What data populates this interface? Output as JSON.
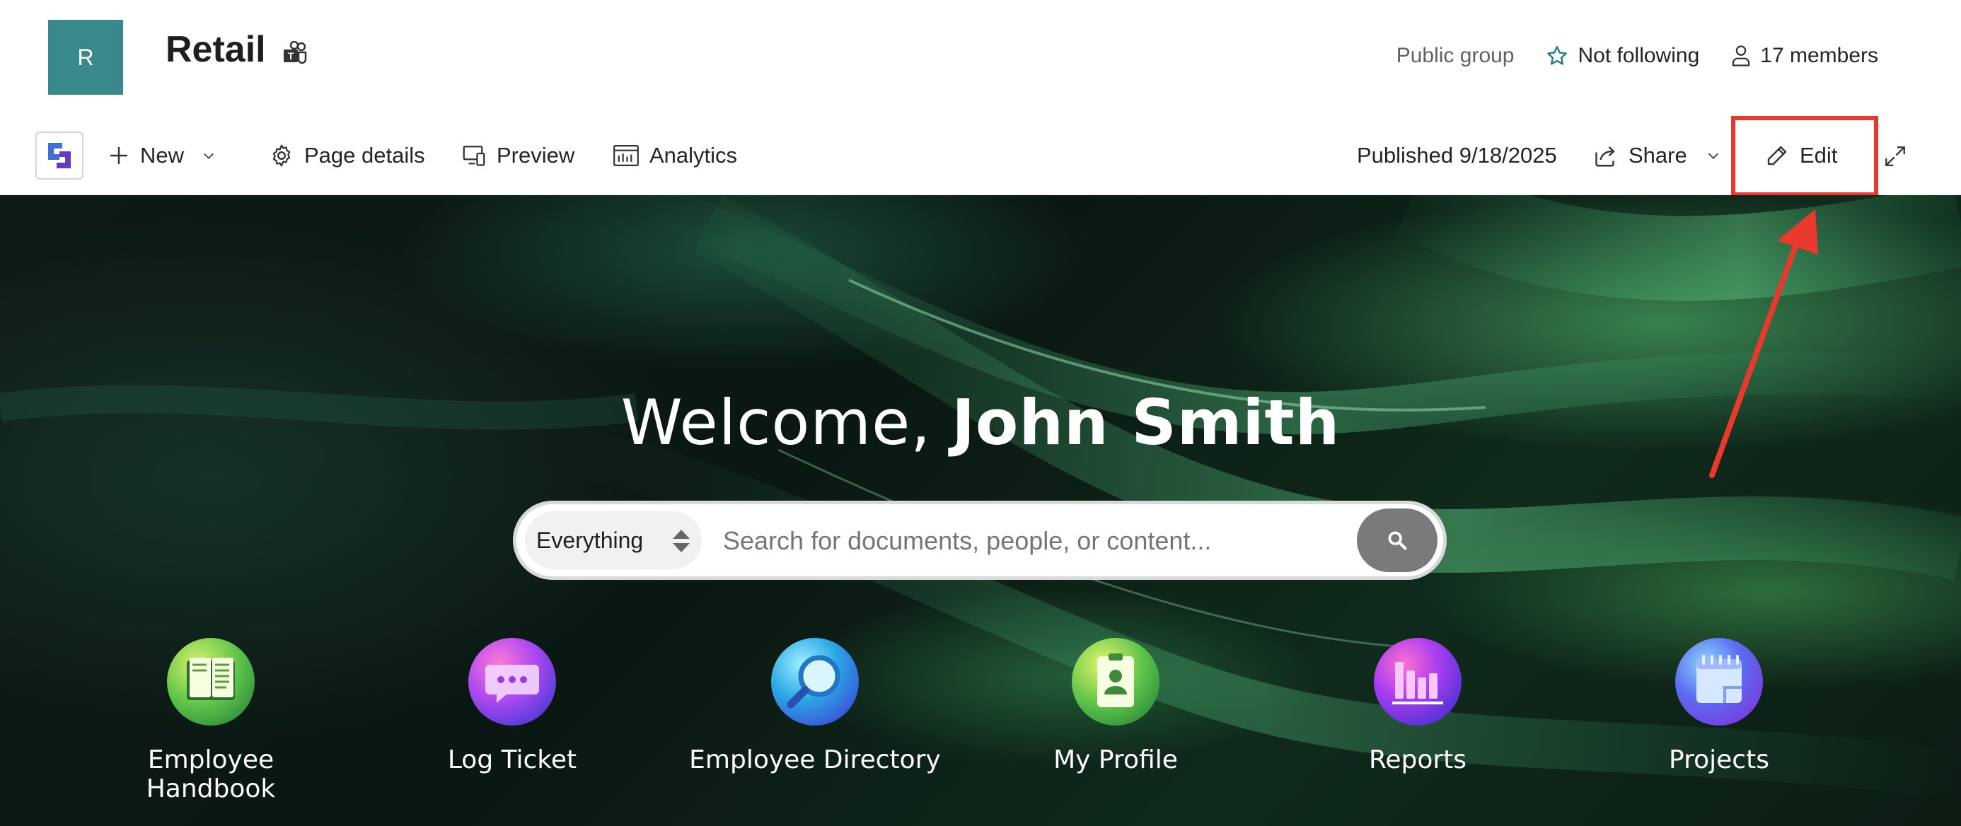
{
  "site": {
    "logo_letter": "R",
    "title": "Retail",
    "privacy": "Public group",
    "follow_label": "Not following",
    "members_label": "17 members"
  },
  "command_bar": {
    "new_label": "New",
    "page_details_label": "Page details",
    "preview_label": "Preview",
    "analytics_label": "Analytics",
    "published_label": "Published 9/18/2025",
    "share_label": "Share",
    "edit_label": "Edit"
  },
  "hero": {
    "welcome_prefix": "Welcome, ",
    "user_name": "John Smith",
    "search": {
      "scope": "Everything",
      "placeholder": "Search for documents, people, or content..."
    },
    "quick_links": [
      {
        "label": "Employee Handbook",
        "icon": "book-icon"
      },
      {
        "label": "Log Ticket",
        "icon": "chat-bubble-icon"
      },
      {
        "label": "Employee Directory",
        "icon": "magnifier-icon"
      },
      {
        "label": "My Profile",
        "icon": "id-badge-icon"
      },
      {
        "label": "Reports",
        "icon": "bar-chart-icon"
      },
      {
        "label": "Projects",
        "icon": "notepad-icon"
      }
    ]
  },
  "colors": {
    "logo_bg": "#3a8a8c",
    "annotation": "#e8392c",
    "hero_dark": "#0a1712",
    "hero_green": "#5ac878"
  }
}
